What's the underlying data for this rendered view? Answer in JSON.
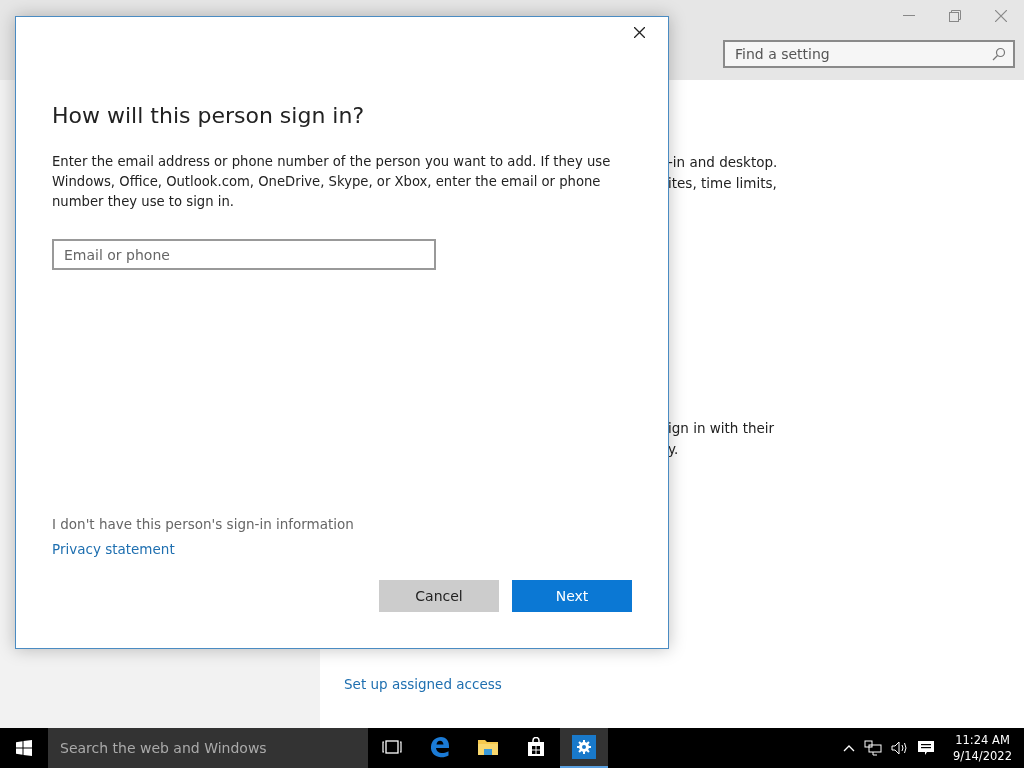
{
  "settings_window": {
    "search": {
      "placeholder": "Find a setting"
    },
    "paragraphs": [
      [
        "-in and desktop.",
        "ites, time limits,"
      ],
      [
        "ign in with their",
        "y."
      ]
    ],
    "link": "Set up assigned access"
  },
  "dialog": {
    "title": "How will this person sign in?",
    "description": "Enter the email address or phone number of the person you want to add. If they use Windows, Office, Outlook.com, OneDrive, Skype, or Xbox, enter the email or phone number they use to sign in.",
    "field": {
      "placeholder": "Email or phone"
    },
    "no_info_link": "I don't have this person's sign-in information",
    "privacy_link": "Privacy statement",
    "buttons": [
      {
        "label": "Cancel",
        "kind": "secondary"
      },
      {
        "label": "Next",
        "kind": "primary"
      }
    ]
  },
  "taskbar": {
    "search": {
      "placeholder": "Search the web and Windows"
    },
    "apps": [
      {
        "kind": "taskview",
        "selected": false
      },
      {
        "kind": "edge",
        "selected": false
      },
      {
        "kind": "explorer",
        "selected": false
      },
      {
        "kind": "store",
        "selected": false
      },
      {
        "kind": "settings",
        "selected": true
      }
    ],
    "clock": {
      "time": "11:24 AM",
      "date": "9/14/2022"
    }
  }
}
